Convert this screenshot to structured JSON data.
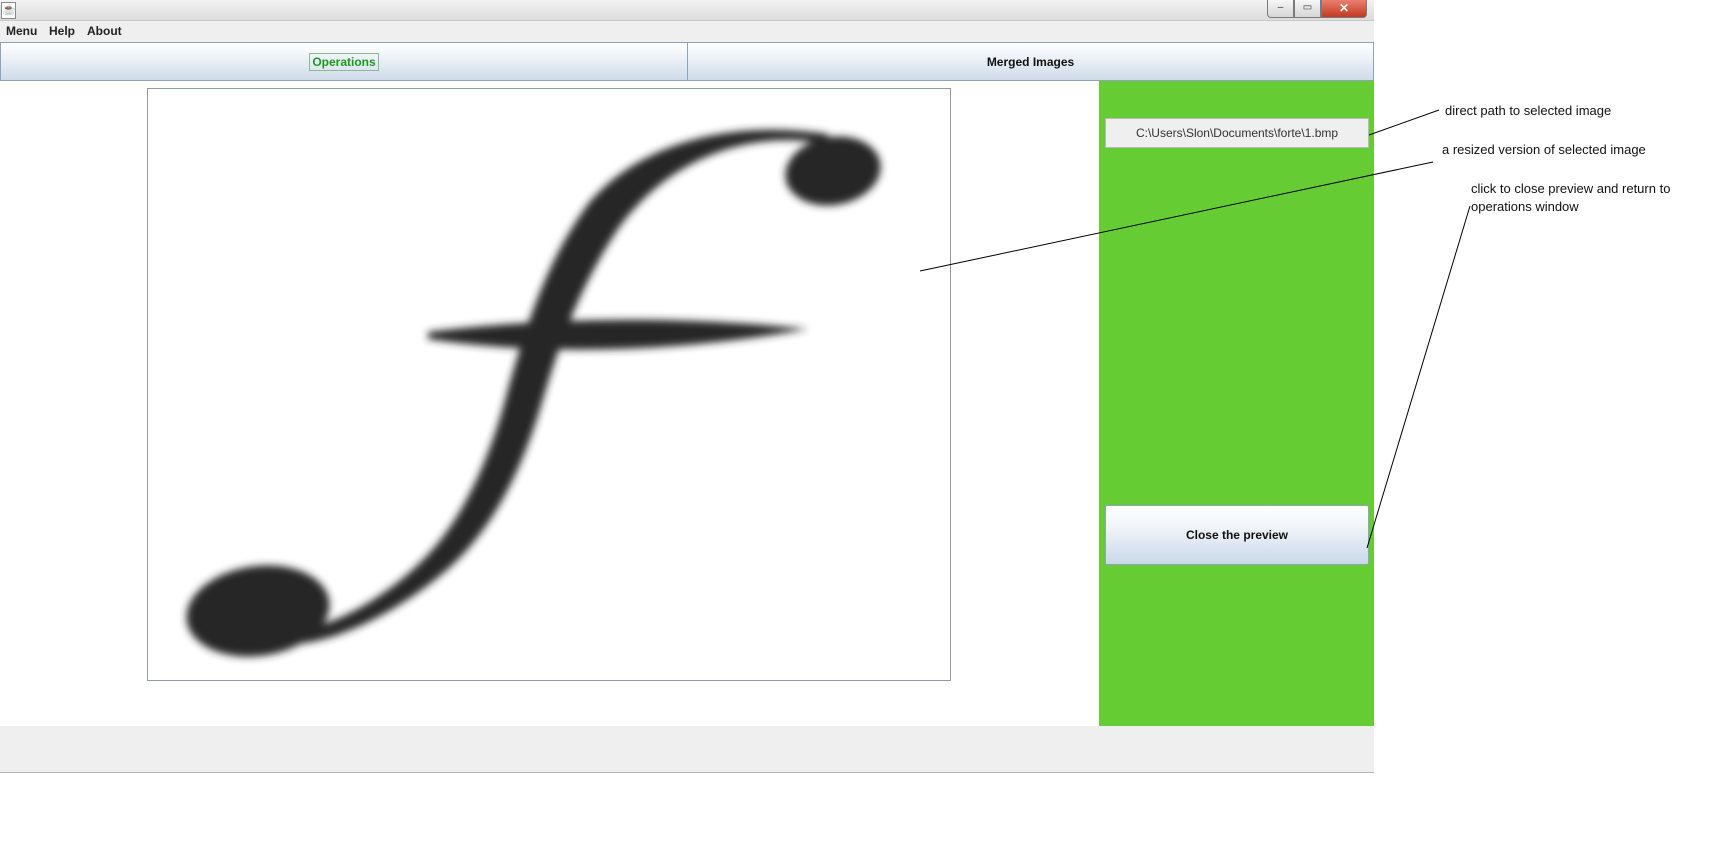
{
  "window": {
    "app_icon": "java-icon",
    "controls": {
      "minimize": "–",
      "maximize": "▭",
      "close": "✕"
    }
  },
  "menubar": {
    "items": [
      "Menu",
      "Help",
      "About"
    ]
  },
  "tabs": [
    {
      "label": "Operations",
      "selected": true
    },
    {
      "label": "Merged Images",
      "selected": false
    }
  ],
  "preview": {
    "image": "script-f-letter"
  },
  "side_panel": {
    "path": "C:\\Users\\Slon\\Documents\\forte\\1.bmp",
    "close_button": "Close the preview",
    "color": "#66cc33"
  },
  "annotations": {
    "path_note": "direct path to selected image",
    "image_note": "a resized version of selected image",
    "close_note_line1": "click to close preview and return to",
    "close_note_line2": "operations window"
  },
  "colors": {
    "accent_tab_text": "#1a9a1a",
    "panel_green": "#66cc33"
  }
}
